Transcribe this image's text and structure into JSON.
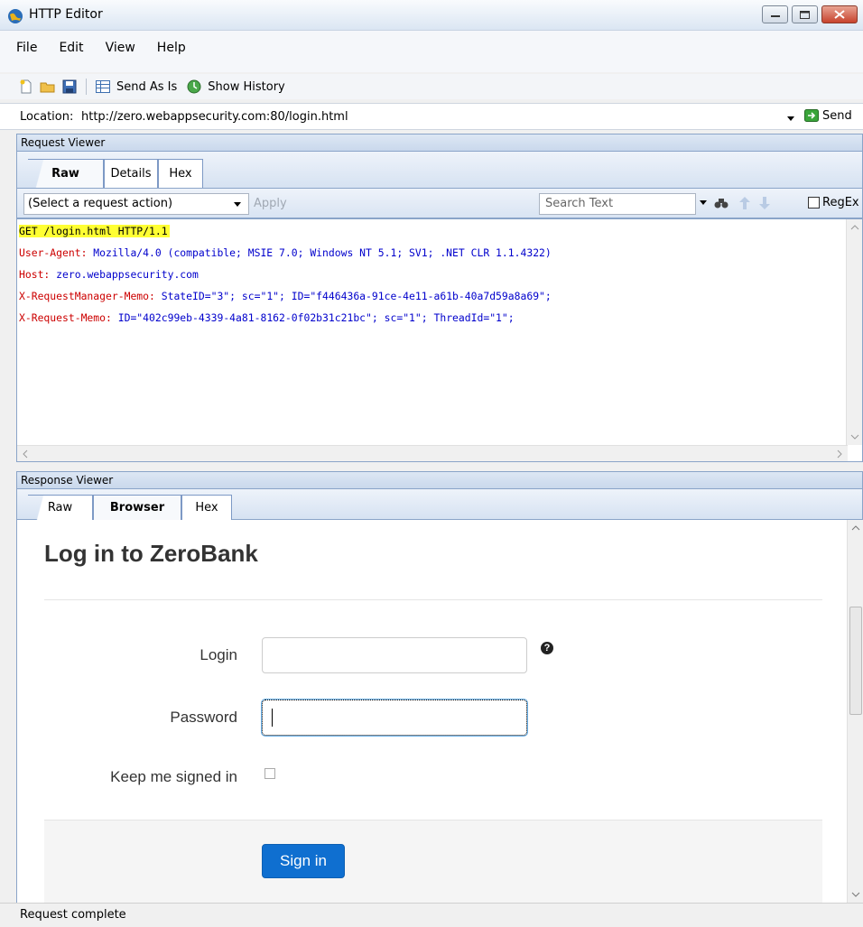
{
  "window": {
    "title": "HTTP Editor"
  },
  "menu": [
    "File",
    "Edit",
    "View",
    "Help"
  ],
  "toolbar": {
    "send_as_is": "Send As Is",
    "show_history": "Show History"
  },
  "location": {
    "label": "Location:",
    "url": "http://zero.webappsecurity.com:80/login.html",
    "send_label": "Send"
  },
  "request_viewer": {
    "header": "Request Viewer",
    "tabs": [
      "Raw",
      "Details",
      "Hex"
    ],
    "active_tab": "Raw",
    "action_select": "(Select a request action)",
    "apply_label": "Apply",
    "search_placeholder": "Search Text",
    "regex_label": "RegEx",
    "raw": {
      "request_line": "GET /login.html HTTP/1.1",
      "headers": [
        {
          "name": "User-Agent:",
          "value": " Mozilla/4.0 (compatible; MSIE 7.0; Windows NT 5.1; SV1; .NET CLR 1.1.4322)"
        },
        {
          "name": "Host:",
          "value": " zero.webappsecurity.com"
        },
        {
          "name": "X-RequestManager-Memo:",
          "value": " StateID=\"3\"; sc=\"1\"; ID=\"f446436a-91ce-4e11-a61b-40a7d59a8a69\";"
        },
        {
          "name": "X-Request-Memo:",
          "value": " ID=\"402c99eb-4339-4a81-8162-0f02b31c21bc\"; sc=\"1\"; ThreadId=\"1\";"
        }
      ]
    }
  },
  "response_viewer": {
    "header": "Response Viewer",
    "tabs": [
      "Raw",
      "Browser",
      "Hex"
    ],
    "active_tab": "Browser",
    "page": {
      "title": "Log in to ZeroBank",
      "login_label": "Login",
      "password_label": "Password",
      "remember_label": "Keep me signed in",
      "signin_label": "Sign in"
    }
  },
  "status": {
    "text": "Request complete"
  },
  "colors": {
    "panel_border": "#8aa4c8",
    "header_key": "#cc0000",
    "header_value": "#0000cc",
    "highlight": "#ffff33",
    "signin_button": "#0f6fd0"
  }
}
